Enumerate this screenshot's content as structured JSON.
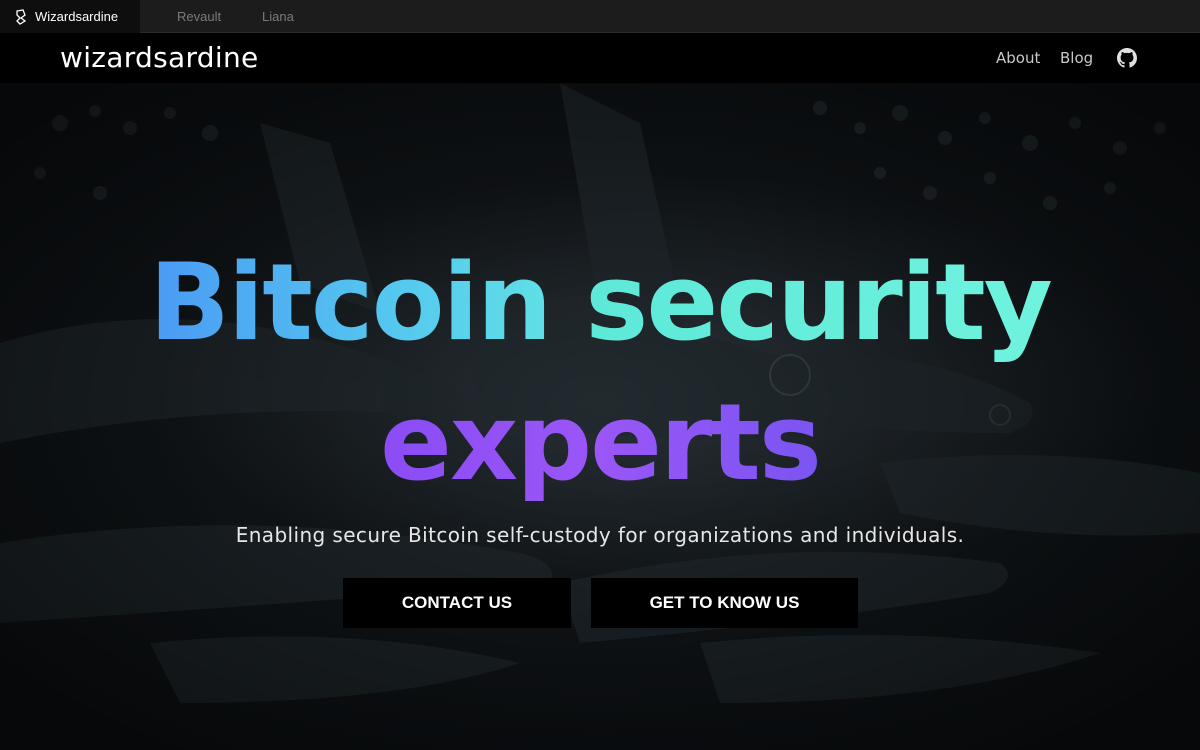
{
  "tabs": [
    {
      "label": "Wizardsardine",
      "active": true
    },
    {
      "label": "Revault",
      "active": false
    },
    {
      "label": "Liana",
      "active": false
    }
  ],
  "header": {
    "brand": "wizardsardine",
    "nav": {
      "about": "About",
      "blog": "Blog"
    },
    "github_icon": "github-icon"
  },
  "hero": {
    "headline_word1": "Bitcoin",
    "headline_word2": "security",
    "headline_line2": "experts",
    "tagline": "Enabling secure Bitcoin self-custody for organizations and individuals.",
    "buttons": {
      "contact": "CONTACT US",
      "know": "GET TO KNOW US"
    }
  },
  "colors": {
    "headline_blue": "#4a9af4",
    "headline_teal": "#6ff3de",
    "headline_purple": "#9a56f7",
    "header_bg": "#000000",
    "button_bg": "#000000"
  }
}
